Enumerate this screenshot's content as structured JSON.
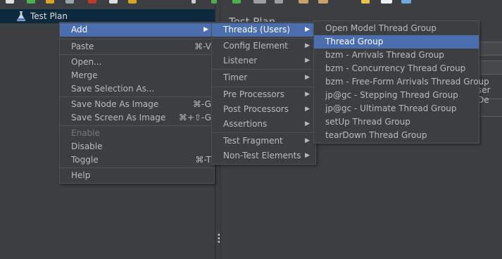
{
  "tree": {
    "root_label": "Test Plan"
  },
  "right_panel": {
    "title": "Test Plan",
    "partial_text": "ser De"
  },
  "context_menu": {
    "add": "Add",
    "paste": "Paste",
    "paste_shortcut": "⌘-V",
    "open": "Open...",
    "merge": "Merge",
    "save_selection_as": "Save Selection As...",
    "save_node_as_image": "Save Node As Image",
    "save_node_shortcut": "⌘-G",
    "save_screen_as_image": "Save Screen As Image",
    "save_screen_shortcut": "⌘+⇧-G",
    "enable": "Enable",
    "disable": "Disable",
    "toggle": "Toggle",
    "toggle_shortcut": "⌘-T",
    "help": "Help"
  },
  "add_submenu": {
    "threads_users": "Threads (Users)",
    "config_element": "Config Element",
    "listener": "Listener",
    "timer": "Timer",
    "pre_processors": "Pre Processors",
    "post_processors": "Post Processors",
    "assertions": "Assertions",
    "test_fragment": "Test Fragment",
    "non_test_elements": "Non-Test Elements"
  },
  "threads_submenu": {
    "open_model": "Open Model Thread Group",
    "thread_group": "Thread Group",
    "bzm_arrivals": "bzm - Arrivals Thread Group",
    "bzm_concurrency": "bzm - Concurrency Thread Group",
    "bzm_free_form": "bzm - Free-Form Arrivals Thread Group",
    "jpgc_stepping": "jp@gc - Stepping Thread Group",
    "jpgc_ultimate": "jp@gc - Ultimate Thread Group",
    "setup": "setUp Thread Group",
    "teardown": "tearDown Thread Group"
  },
  "colors": {
    "selection": "#4b6eaf",
    "background": "#3c3f41",
    "tree_selection": "#0d293e"
  },
  "icons": {
    "tree_root": "flask-icon",
    "submenu": "triangle-right-icon"
  }
}
